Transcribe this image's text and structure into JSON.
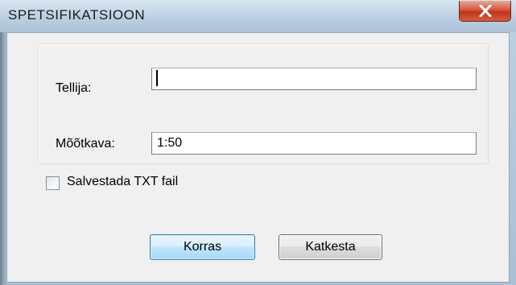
{
  "window": {
    "title": "SPETSIFIKATSIOON",
    "close_symbol": "x"
  },
  "form": {
    "customer_label": "Tellija:",
    "customer_value": "",
    "scale_label": "Mõõtkava:",
    "scale_value": "1:50",
    "save_txt_label": "Salvestada TXT fail",
    "save_txt_checked": false
  },
  "buttons": {
    "ok_label": "Korras",
    "cancel_label": "Katkesta"
  },
  "icons": {
    "close": "close-icon"
  },
  "colors": {
    "close_button": "#c3331a",
    "default_button_border": "#3c7fb1"
  }
}
